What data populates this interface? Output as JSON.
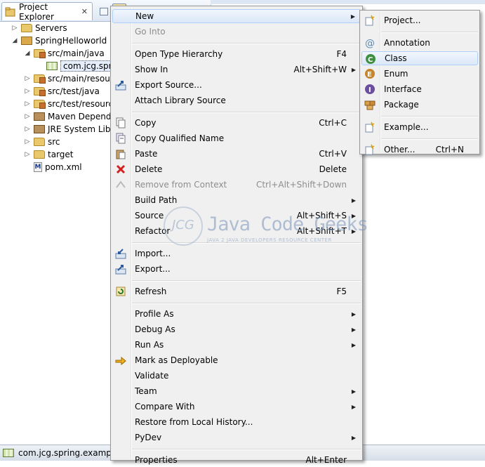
{
  "explorer": {
    "tab_label": "Project Explorer",
    "close_glyph": "✕",
    "tree": [
      {
        "label": "Servers",
        "indent": 1,
        "twisty": "▷",
        "icon": "folder-icon"
      },
      {
        "label": "SpringHelloworld",
        "indent": 1,
        "twisty": "◢",
        "icon": "project-icon"
      },
      {
        "label": "src/main/java",
        "indent": 2,
        "twisty": "◢",
        "icon": "source-folder-icon"
      },
      {
        "label": "com.jcg.spring.example",
        "indent": 3,
        "twisty": "",
        "icon": "package-icon",
        "selected": true
      },
      {
        "label": "src/main/resources",
        "indent": 2,
        "twisty": "▷",
        "icon": "source-folder-icon"
      },
      {
        "label": "src/test/java",
        "indent": 2,
        "twisty": "▷",
        "icon": "source-folder-icon"
      },
      {
        "label": "src/test/resources",
        "indent": 2,
        "twisty": "▷",
        "icon": "source-folder-icon"
      },
      {
        "label": "Maven Dependencies",
        "indent": 2,
        "twisty": "▷",
        "icon": "library-icon"
      },
      {
        "label": "JRE System Library",
        "indent": 2,
        "twisty": "▷",
        "icon": "library-icon"
      },
      {
        "label": "src",
        "indent": 2,
        "twisty": "▷",
        "icon": "folder-icon"
      },
      {
        "label": "target",
        "indent": 2,
        "twisty": "▷",
        "icon": "folder-icon"
      },
      {
        "label": "pom.xml",
        "indent": 2,
        "twisty": "",
        "icon": "pom-file-icon"
      }
    ]
  },
  "statusbar": {
    "text": "com.jcg.spring.example - "
  },
  "context_menu": {
    "items": [
      {
        "type": "item",
        "label": "New",
        "accel": "",
        "submenu": true,
        "highlight": true,
        "icon": ""
      },
      {
        "type": "item",
        "label": "Go Into",
        "accel": "",
        "disabled": true,
        "icon": ""
      },
      {
        "type": "sep"
      },
      {
        "type": "item",
        "label": "Open Type Hierarchy",
        "accel": "F4",
        "icon": ""
      },
      {
        "type": "item",
        "label": "Show In",
        "accel": "Alt+Shift+W",
        "submenu": true,
        "icon": ""
      },
      {
        "type": "item",
        "label": "Export Source...",
        "accel": "",
        "icon": "export-source-icon"
      },
      {
        "type": "item",
        "label": "Attach Library Source",
        "accel": "",
        "icon": ""
      },
      {
        "type": "sep"
      },
      {
        "type": "item",
        "label": "Copy",
        "accel": "Ctrl+C",
        "icon": "copy-icon"
      },
      {
        "type": "item",
        "label": "Copy Qualified Name",
        "accel": "",
        "icon": "copy-qualified-icon"
      },
      {
        "type": "item",
        "label": "Paste",
        "accel": "Ctrl+V",
        "icon": "paste-icon"
      },
      {
        "type": "item",
        "label": "Delete",
        "accel": "Delete",
        "icon": "delete-icon"
      },
      {
        "type": "item",
        "label": "Remove from Context",
        "accel": "Ctrl+Alt+Shift+Down",
        "disabled": true,
        "icon": "remove-context-icon"
      },
      {
        "type": "item",
        "label": "Build Path",
        "accel": "",
        "submenu": true,
        "icon": ""
      },
      {
        "type": "item",
        "label": "Source",
        "accel": "Alt+Shift+S",
        "submenu": true,
        "icon": ""
      },
      {
        "type": "item",
        "label": "Refactor",
        "accel": "Alt+Shift+T",
        "submenu": true,
        "icon": ""
      },
      {
        "type": "sep"
      },
      {
        "type": "item",
        "label": "Import...",
        "accel": "",
        "icon": "import-icon"
      },
      {
        "type": "item",
        "label": "Export...",
        "accel": "",
        "icon": "export-icon"
      },
      {
        "type": "sep"
      },
      {
        "type": "item",
        "label": "Refresh",
        "accel": "F5",
        "icon": "refresh-icon"
      },
      {
        "type": "sep"
      },
      {
        "type": "item",
        "label": "Profile As",
        "accel": "",
        "submenu": true,
        "icon": ""
      },
      {
        "type": "item",
        "label": "Debug As",
        "accel": "",
        "submenu": true,
        "icon": ""
      },
      {
        "type": "item",
        "label": "Run As",
        "accel": "",
        "submenu": true,
        "icon": ""
      },
      {
        "type": "item",
        "label": "Mark as Deployable",
        "accel": "",
        "icon": "deployable-icon"
      },
      {
        "type": "item",
        "label": "Validate",
        "accel": "",
        "icon": ""
      },
      {
        "type": "item",
        "label": "Team",
        "accel": "",
        "submenu": true,
        "icon": ""
      },
      {
        "type": "item",
        "label": "Compare With",
        "accel": "",
        "submenu": true,
        "icon": ""
      },
      {
        "type": "item",
        "label": "Restore from Local History...",
        "accel": "",
        "icon": ""
      },
      {
        "type": "item",
        "label": "PyDev",
        "accel": "",
        "submenu": true,
        "icon": ""
      },
      {
        "type": "sep"
      },
      {
        "type": "item",
        "label": "Properties",
        "accel": "Alt+Enter",
        "icon": ""
      }
    ]
  },
  "new_submenu": {
    "items": [
      {
        "type": "item",
        "label": "Project...",
        "accel": "",
        "icon": "new-project-icon"
      },
      {
        "type": "sep"
      },
      {
        "type": "item",
        "label": "Annotation",
        "accel": "",
        "icon": "annotation-icon"
      },
      {
        "type": "item",
        "label": "Class",
        "accel": "",
        "icon": "class-icon",
        "highlight": true
      },
      {
        "type": "item",
        "label": "Enum",
        "accel": "",
        "icon": "enum-icon"
      },
      {
        "type": "item",
        "label": "Interface",
        "accel": "",
        "icon": "interface-icon"
      },
      {
        "type": "item",
        "label": "Package",
        "accel": "",
        "icon": "package-icon"
      },
      {
        "type": "sep"
      },
      {
        "type": "item",
        "label": "Example...",
        "accel": "",
        "icon": "example-icon"
      },
      {
        "type": "sep"
      },
      {
        "type": "item",
        "label": "Other...",
        "accel": "Ctrl+N",
        "icon": "other-wizard-icon"
      }
    ]
  },
  "watermark": {
    "title": "Java Code Geeks",
    "subtitle": "JAVA 2 JAVA DEVELOPERS RESOURCE CENTER",
    "logo_text": "JCG"
  },
  "colors": {
    "highlight_border": "#aecff7",
    "menu_bg": "#f0f0f0",
    "delete_red": "#d32020",
    "class_green": "#3f8f3f",
    "enum_orange": "#c8842a",
    "interface_purple": "#6b4ea0"
  }
}
